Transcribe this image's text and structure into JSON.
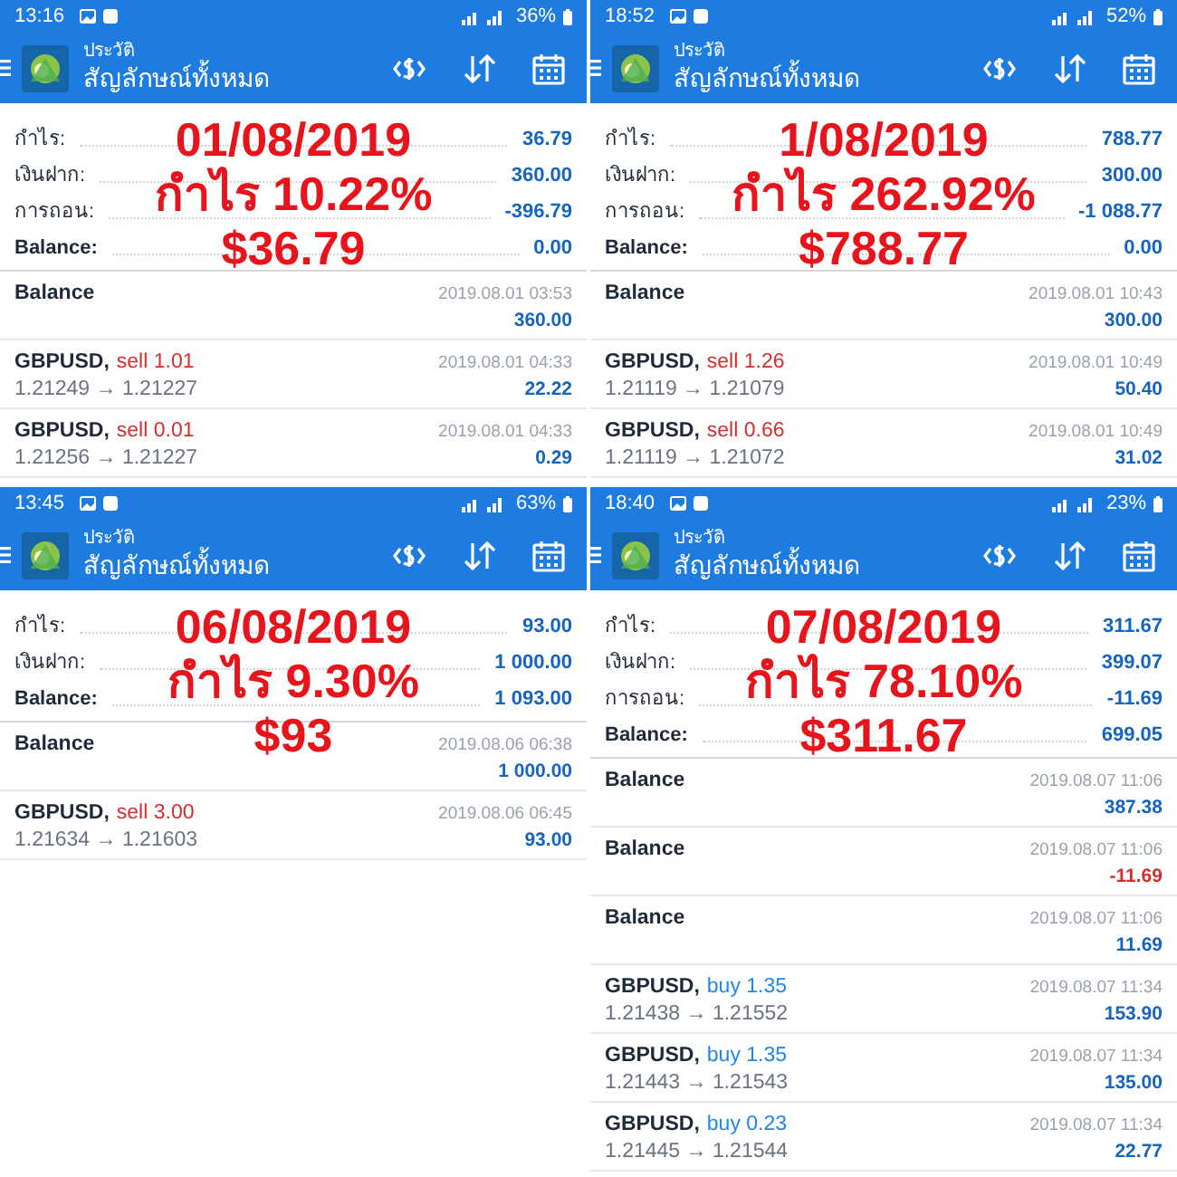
{
  "panels": [
    {
      "status_bar": {
        "time": "13:16",
        "battery": "36%"
      },
      "app_bar": {
        "subtitle": "ประวัติ",
        "title": "สัญลักษณ์ทั้งหมด"
      },
      "summary": [
        {
          "label": "กำไร:",
          "value": "36.79"
        },
        {
          "label": "เงินฝาก:",
          "value": "360.00"
        },
        {
          "label": "การถอน:",
          "value": "-396.79"
        },
        {
          "label": "Balance:",
          "value": "0.00"
        }
      ],
      "overlay": [
        "01/08/2019",
        "กำไร 10.22%",
        "$36.79"
      ],
      "deals": [
        {
          "kind": "balance",
          "symbol": "Balance",
          "time": "2019.08.01 03:53",
          "profit": "360.00",
          "loss": false
        },
        {
          "kind": "trade",
          "symbol": "GBPUSD,",
          "order": "sell 1.01",
          "color": "#d32f2f",
          "prices": "1.21249 → 1.21227",
          "time": "2019.08.01 04:33",
          "profit": "22.22",
          "loss": false
        },
        {
          "kind": "trade",
          "symbol": "GBPUSD,",
          "order": "sell 0.01",
          "color": "#d32f2f",
          "prices": "1.21256 → 1.21227",
          "time": "2019.08.01 04:33",
          "profit": "0.29",
          "loss": false
        }
      ]
    },
    {
      "status_bar": {
        "time": "18:52",
        "battery": "52%"
      },
      "app_bar": {
        "subtitle": "ประวัติ",
        "title": "สัญลักษณ์ทั้งหมด"
      },
      "summary": [
        {
          "label": "กำไร:",
          "value": "788.77"
        },
        {
          "label": "เงินฝาก:",
          "value": "300.00"
        },
        {
          "label": "การถอน:",
          "value": "-1 088.77"
        },
        {
          "label": "Balance:",
          "value": "0.00"
        }
      ],
      "overlay": [
        "1/08/2019",
        "กำไร 262.92%",
        "$788.77"
      ],
      "deals": [
        {
          "kind": "balance",
          "symbol": "Balance",
          "time": "2019.08.01 10:43",
          "profit": "300.00",
          "loss": false
        },
        {
          "kind": "trade",
          "symbol": "GBPUSD,",
          "order": "sell 1.26",
          "color": "#d32f2f",
          "prices": "1.21119 → 1.21079",
          "time": "2019.08.01 10:49",
          "profit": "50.40",
          "loss": false
        },
        {
          "kind": "trade",
          "symbol": "GBPUSD,",
          "order": "sell 0.66",
          "color": "#d32f2f",
          "prices": "1.21119 → 1.21072",
          "time": "2019.08.01 10:49",
          "profit": "31.02",
          "loss": false
        }
      ]
    },
    {
      "status_bar": {
        "time": "13:45",
        "battery": "63%"
      },
      "app_bar": {
        "subtitle": "ประวัติ",
        "title": "สัญลักษณ์ทั้งหมด"
      },
      "summary": [
        {
          "label": "กำไร:",
          "value": "93.00"
        },
        {
          "label": "เงินฝาก:",
          "value": "1 000.00"
        },
        {
          "label": "Balance:",
          "value": "1 093.00"
        }
      ],
      "overlay": [
        "06/08/2019",
        "กำไร 9.30%",
        "$93"
      ],
      "deals": [
        {
          "kind": "balance",
          "symbol": "Balance",
          "time": "2019.08.06 06:38",
          "profit": "1 000.00",
          "loss": false
        },
        {
          "kind": "trade",
          "symbol": "GBPUSD,",
          "order": "sell 3.00",
          "color": "#d32f2f",
          "prices": "1.21634 → 1.21603",
          "time": "2019.08.06 06:45",
          "profit": "93.00",
          "loss": false
        }
      ]
    },
    {
      "status_bar": {
        "time": "18:40",
        "battery": "23%"
      },
      "app_bar": {
        "subtitle": "ประวัติ",
        "title": "สัญลักษณ์ทั้งหมด"
      },
      "summary": [
        {
          "label": "กำไร:",
          "value": "311.67"
        },
        {
          "label": "เงินฝาก:",
          "value": "399.07"
        },
        {
          "label": "การถอน:",
          "value": "-11.69"
        },
        {
          "label": "Balance:",
          "value": "699.05"
        }
      ],
      "overlay": [
        "07/08/2019",
        "กำไร 78.10%",
        "$311.67"
      ],
      "deals": [
        {
          "kind": "balance",
          "symbol": "Balance",
          "time": "2019.08.07 11:06",
          "profit": "387.38",
          "loss": false
        },
        {
          "kind": "balance",
          "symbol": "Balance",
          "time": "2019.08.07 11:06",
          "profit": "-11.69",
          "loss": true
        },
        {
          "kind": "balance",
          "symbol": "Balance",
          "time": "2019.08.07 11:06",
          "profit": "11.69",
          "loss": false
        },
        {
          "kind": "trade",
          "symbol": "GBPUSD,",
          "order": "buy 1.35",
          "color": "#1e88e5",
          "prices": "1.21438 → 1.21552",
          "time": "2019.08.07 11:34",
          "profit": "153.90",
          "loss": false
        },
        {
          "kind": "trade",
          "symbol": "GBPUSD,",
          "order": "buy 1.35",
          "color": "#1e88e5",
          "prices": "1.21443 → 1.21543",
          "time": "2019.08.07 11:34",
          "profit": "135.00",
          "loss": false
        },
        {
          "kind": "trade",
          "symbol": "GBPUSD,",
          "order": "buy 0.23",
          "color": "#1e88e5",
          "prices": "1.21445 → 1.21544",
          "time": "2019.08.07 11:34",
          "profit": "22.77",
          "loss": false
        }
      ]
    }
  ]
}
